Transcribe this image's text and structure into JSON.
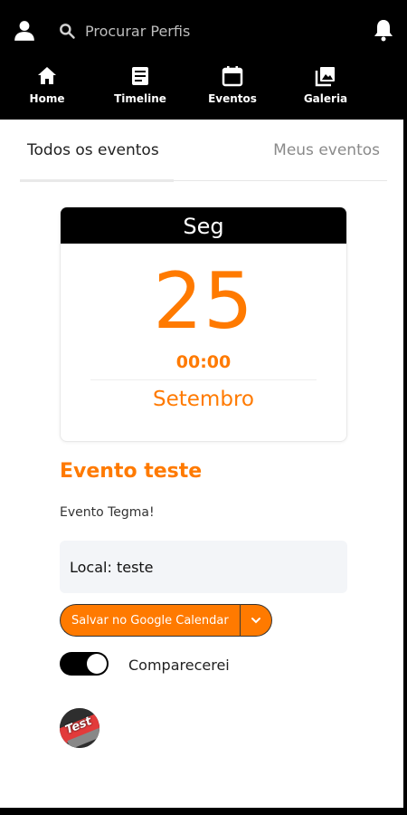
{
  "header": {
    "search_placeholder": "Procurar Perfis",
    "icons": [
      "user-icon",
      "search-icon",
      "bell-icon"
    ]
  },
  "nav": {
    "items": [
      {
        "label": "Home",
        "icon": "home-icon"
      },
      {
        "label": "Timeline",
        "icon": "timeline-icon"
      },
      {
        "label": "Eventos",
        "icon": "calendar-icon"
      },
      {
        "label": "Galeria",
        "icon": "gallery-icon"
      }
    ]
  },
  "tabs": {
    "all": "Todos os eventos",
    "mine": "Meus eventos",
    "active": "all"
  },
  "event": {
    "weekday": "Seg",
    "day": "25",
    "time": "00:00",
    "month": "Setembro",
    "title": "Evento teste",
    "description": "Evento Tegma!",
    "location": "Local: teste",
    "gcal_button": "Salvar no Google Calendar",
    "attend_label": "Comparecerei",
    "attend_toggle_on": true,
    "avatar_text": "Test"
  },
  "colors": {
    "accent": "#ff7a00",
    "header_bg": "#000000",
    "local_bg": "#f3f5f8"
  }
}
